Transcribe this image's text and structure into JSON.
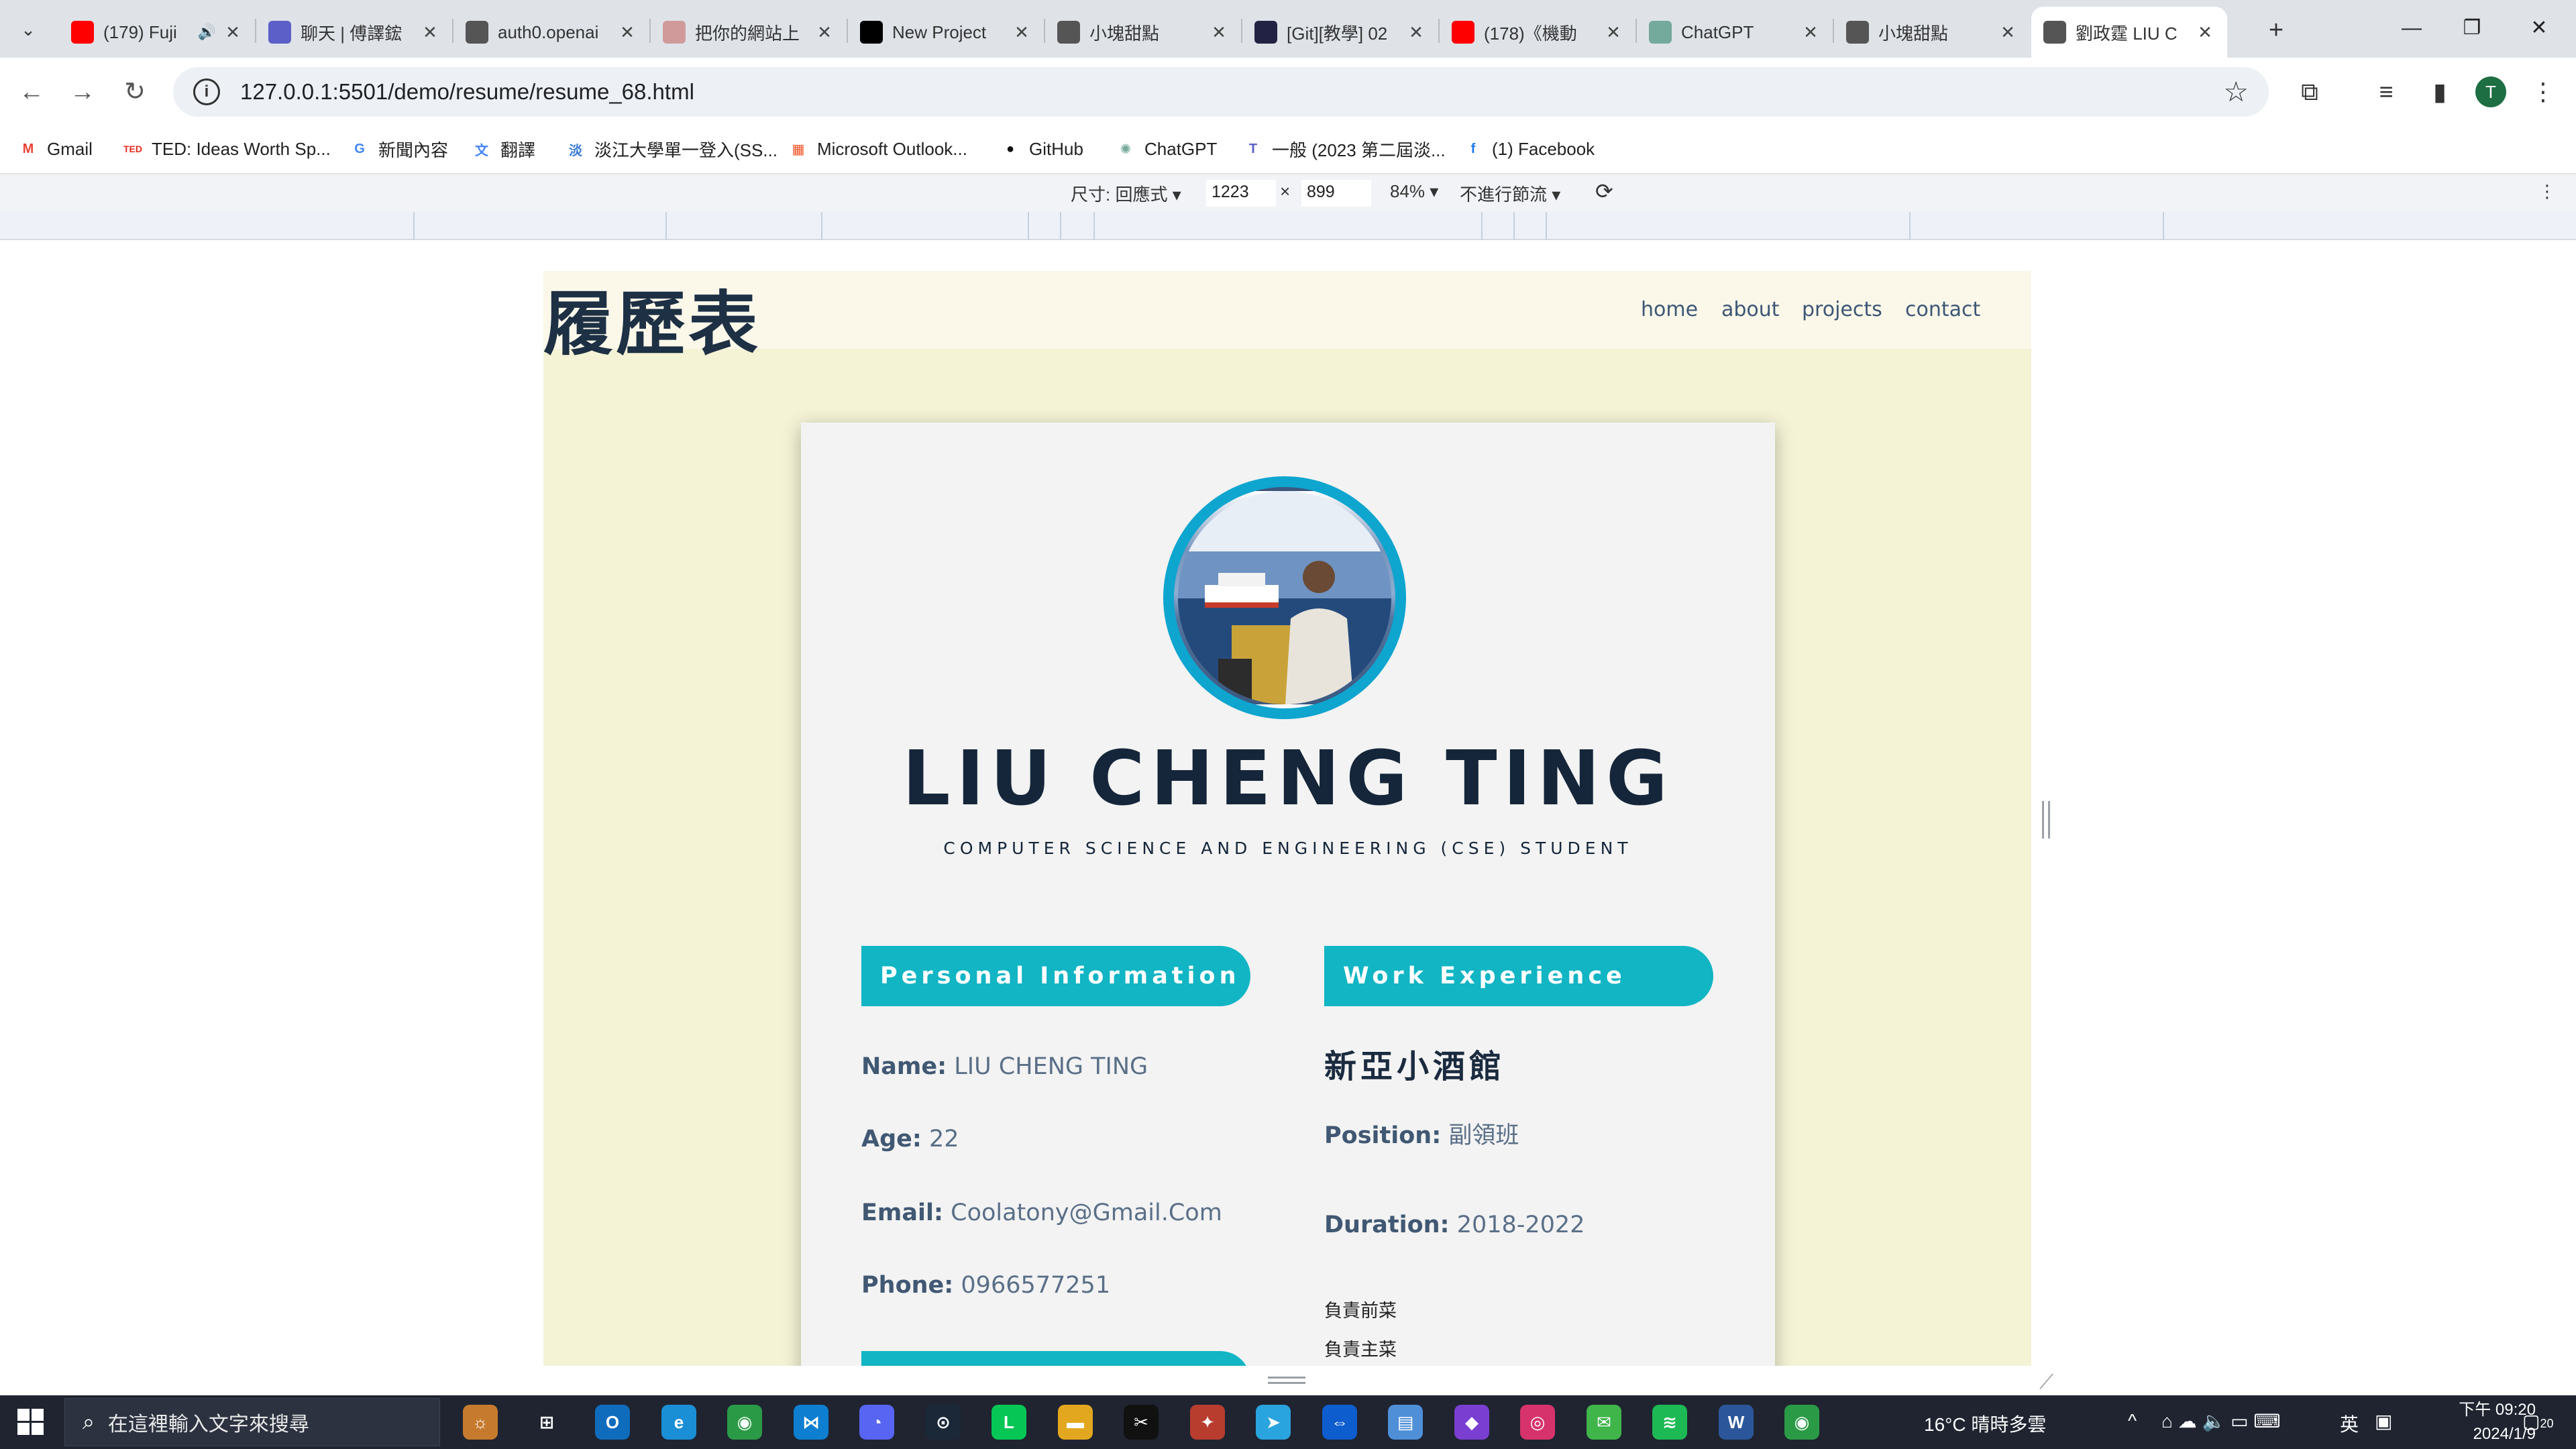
{
  "browser": {
    "tabs": [
      {
        "title": "(179) Fuji",
        "favicon": "youtube-icon",
        "color": "#ff0000",
        "audio": true
      },
      {
        "title": "聊天 | 傅譯鋐",
        "favicon": "teams-icon",
        "color": "#5b5fc7"
      },
      {
        "title": "auth0.openai",
        "favicon": "globe-icon",
        "color": "#555555"
      },
      {
        "title": "把你的網站上",
        "favicon": "triangle-icon",
        "color": "#d09a9a"
      },
      {
        "title": "New Project",
        "favicon": "project-icon",
        "color": "#000000"
      },
      {
        "title": "小塊甜點",
        "favicon": "globe-icon",
        "color": "#555555"
      },
      {
        "title": "[Git][教學] 02",
        "favicon": "git-icon",
        "color": "#222244"
      },
      {
        "title": "(178)《機動",
        "favicon": "youtube-icon",
        "color": "#ff0000"
      },
      {
        "title": "ChatGPT",
        "favicon": "chatgpt-icon",
        "color": "#74aa9c"
      },
      {
        "title": "小塊甜點",
        "favicon": "globe-icon",
        "color": "#555555"
      },
      {
        "title": "劉政霆 LIU C",
        "favicon": "globe-icon",
        "color": "#555555",
        "active": true
      }
    ],
    "url": "127.0.0.1:5501/demo/resume/resume_68.html",
    "profile_initial": "T",
    "bookmarks": [
      {
        "label": "Gmail",
        "icon": "gmail-icon",
        "color": "#ea4335",
        "glyph": "M"
      },
      {
        "label": "TED: Ideas Worth Sp...",
        "icon": "ted-icon",
        "color": "#e62b1e",
        "glyph": "TED"
      },
      {
        "label": "新聞內容",
        "icon": "google-news-icon",
        "color": "#4285f4",
        "glyph": "G"
      },
      {
        "label": "翻譯",
        "icon": "translate-icon",
        "color": "#4285f4",
        "glyph": "文"
      },
      {
        "label": "淡江大學單一登入(SS...",
        "icon": "tku-icon",
        "color": "#3a7bd5",
        "glyph": "淡"
      },
      {
        "label": "Microsoft Outlook...",
        "icon": "microsoft-icon",
        "color": "#f25022",
        "glyph": "▦"
      },
      {
        "label": "GitHub",
        "icon": "github-icon",
        "color": "#111111",
        "glyph": "●"
      },
      {
        "label": "ChatGPT",
        "icon": "chatgpt-icon",
        "color": "#74aa9c",
        "glyph": "✺"
      },
      {
        "label": "一般 (2023 第二屆淡...",
        "icon": "teams-icon",
        "color": "#5b5fc7",
        "glyph": "T"
      },
      {
        "label": "(1) Facebook",
        "icon": "facebook-icon",
        "color": "#1877f2",
        "glyph": "f"
      }
    ]
  },
  "devtools": {
    "dimensions_label": "尺寸: 回應式 ▾",
    "width_value": "1223",
    "times": "×",
    "height_value": "899",
    "zoom": "84% ▾",
    "throttle": "不進行節流 ▾"
  },
  "site": {
    "logo": "履歷表",
    "nav": [
      "home",
      "about",
      "projects",
      "contact"
    ],
    "name": "LIU CHENG TING",
    "subtitle": "COMPUTER SCIENCE AND ENGINEERING (CSE) STUDENT",
    "personal_section": "Personal Information",
    "personal": [
      {
        "key": "Name:",
        "value": "LIU CHENG TING"
      },
      {
        "key": "Age:",
        "value": "22"
      },
      {
        "key": "Email:",
        "value": "Coolatony@Gmail.Com"
      },
      {
        "key": "Phone:",
        "value": "0966577251"
      }
    ],
    "work_section": "Work Experience",
    "job": {
      "company": "新亞小酒館",
      "position_key": "Position:",
      "position_value": "副領班",
      "duration_key": "Duration:",
      "duration_value": "2018-2022",
      "duties": [
        "負責前菜",
        "負責主菜"
      ]
    },
    "colors": {
      "accent": "#11b5c4",
      "ring": "#0ea5cf",
      "page_bg": "#f5f3d6",
      "name_color": "#15263a"
    }
  },
  "taskbar": {
    "search_placeholder": "在這裡輸入文字來搜尋",
    "weather": "16°C 晴時多雲",
    "ime": "英",
    "time": "下午 09:20",
    "date": "2024/1/9",
    "notification_count": "20"
  }
}
